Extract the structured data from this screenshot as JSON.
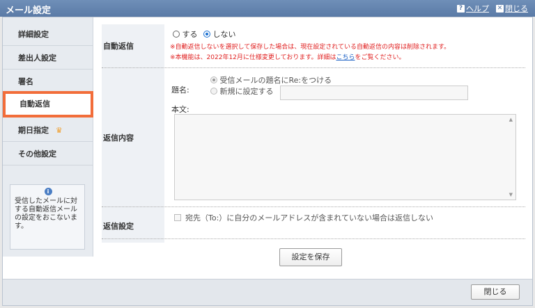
{
  "header": {
    "title": "メール設定",
    "help_label": "ヘルプ",
    "close_label": "閉じる"
  },
  "sidebar": {
    "items": [
      {
        "label": "詳細設定"
      },
      {
        "label": "差出人設定"
      },
      {
        "label": "署名"
      },
      {
        "label": "自動返信"
      },
      {
        "label": "期日指定"
      },
      {
        "label": "その他設定"
      }
    ],
    "active_index": 3,
    "info_text": "受信したメールに対する自動返信メールの設定をおこないます。"
  },
  "auto_reply": {
    "label": "自動返信",
    "option_on": "する",
    "option_off": "しない",
    "selected": "しない",
    "note1": "※自動返信しないを選択して保存した場合は、現在設定されている自動返信の内容は削除されます。",
    "note2_prefix": "※本機能は、2022年12月に仕様変更しております。詳細は",
    "note2_link": "こちら",
    "note2_suffix": "をご覧ください。"
  },
  "reply_content": {
    "label": "返信内容",
    "subject_label": "題名:",
    "subject_option_re": "受信メールの題名にRe:をつける",
    "subject_option_new": "新規に設定する",
    "subject_value": "",
    "body_label": "本文:",
    "body_value": ""
  },
  "reply_settings": {
    "label": "返信設定",
    "checkbox_label": "宛先（To:）に自分のメールアドレスが含まれていない場合は返信しない",
    "checked": false
  },
  "actions": {
    "save_label": "設定を保存",
    "close_label": "閉じる"
  },
  "colors": {
    "title_bar": "#5a7aa6",
    "active_highlight": "#f26d3a",
    "note_red": "#e02020",
    "link_blue": "#1a5fc4"
  }
}
